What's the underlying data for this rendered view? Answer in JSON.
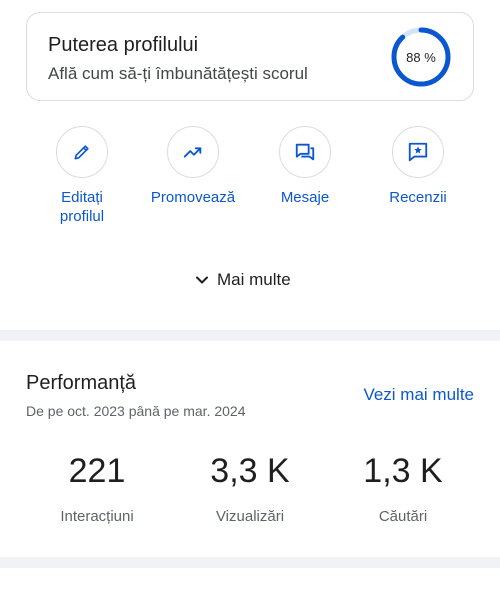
{
  "profile_strength": {
    "title": "Puterea profilului",
    "subtitle": "Află cum să-ți îmbunătățești scorul",
    "percent_label": "88 %",
    "percent_value": 88
  },
  "actions": [
    {
      "label": "Editați\nprofilul",
      "icon": "pencil-icon"
    },
    {
      "label": "Promovează",
      "icon": "trending-up-icon"
    },
    {
      "label": "Mesaje",
      "icon": "chat-icon"
    },
    {
      "label": "Recenzii",
      "icon": "review-star-icon"
    }
  ],
  "more": {
    "label": "Mai multe"
  },
  "performance": {
    "title": "Performanță",
    "date_range": "De pe oct. 2023 până pe mar. 2024",
    "see_more": "Vezi mai multe",
    "stats": [
      {
        "value": "221",
        "label": "Interacțiuni"
      },
      {
        "value": "3,3 K",
        "label": "Vizualizări"
      },
      {
        "value": "1,3 K",
        "label": "Căutări"
      }
    ]
  },
  "colors": {
    "accent": "#0b57d0",
    "ring_track": "#d3e3fd",
    "divider": "#f0f2f5"
  }
}
